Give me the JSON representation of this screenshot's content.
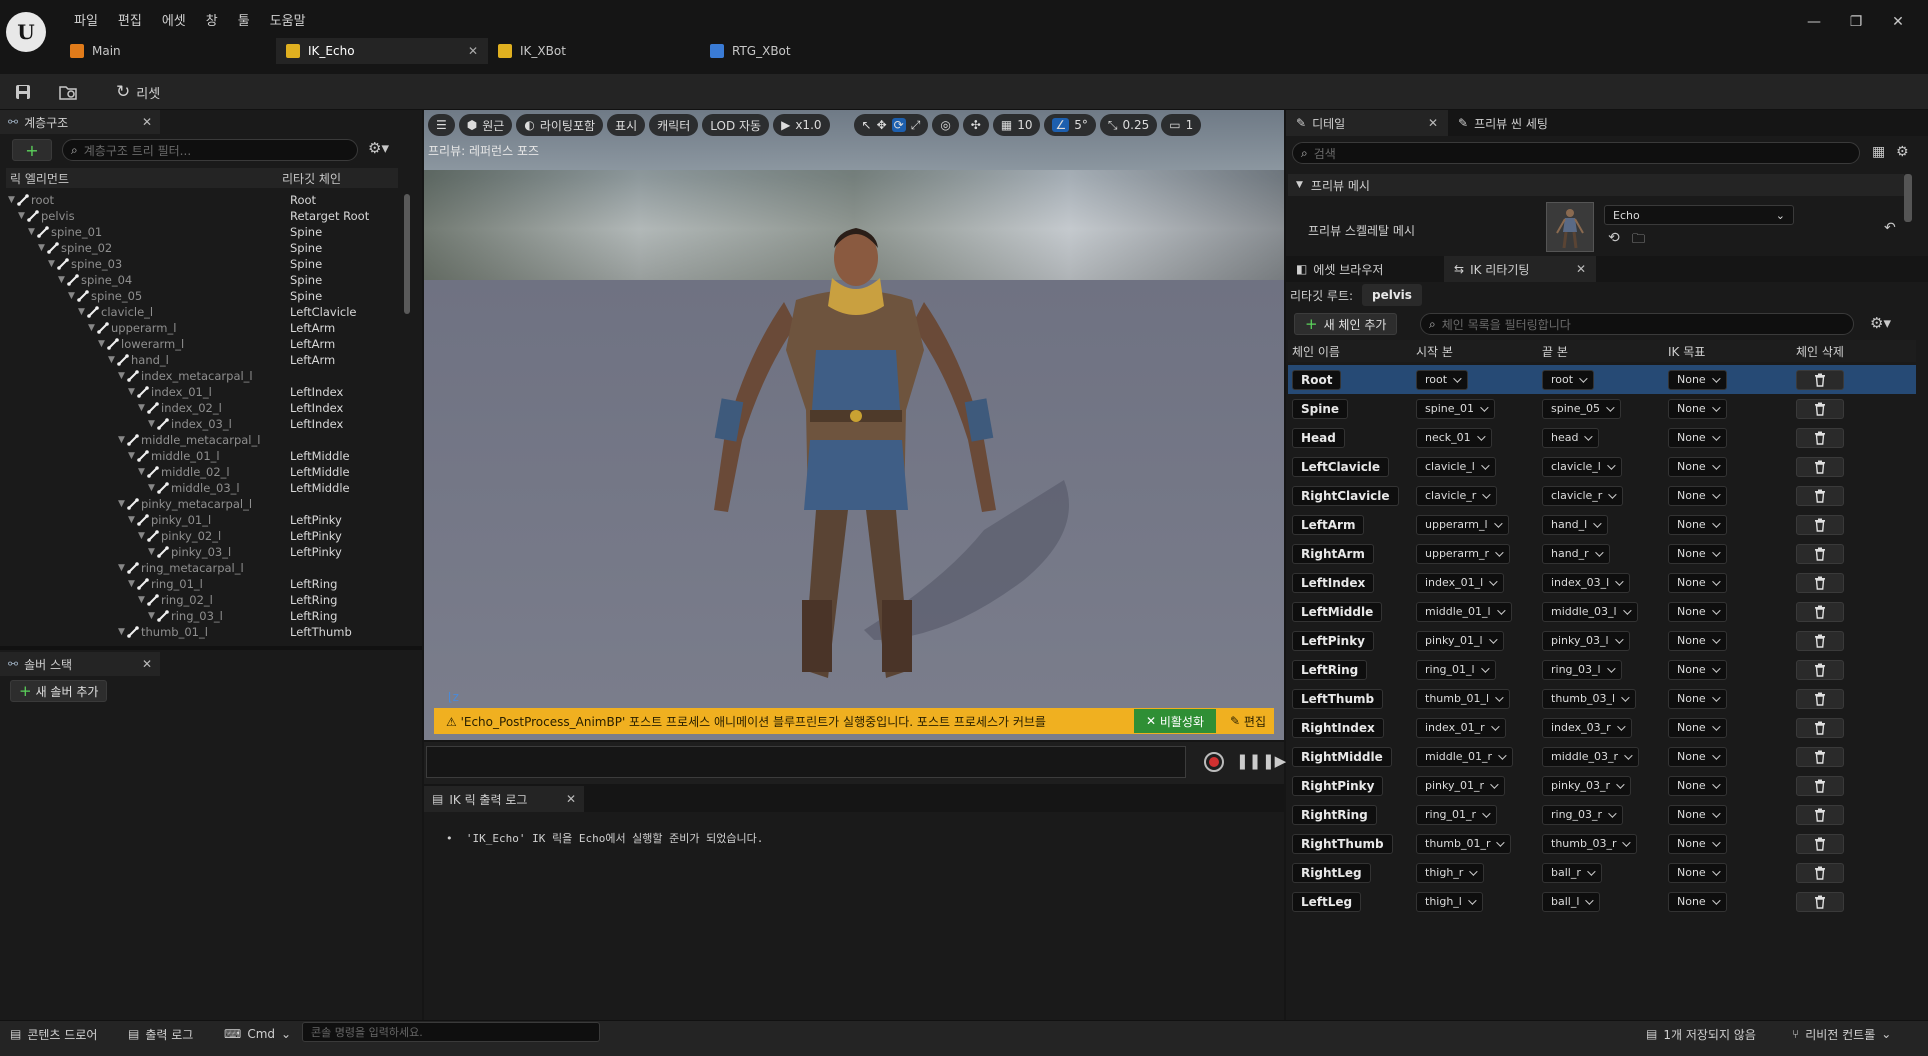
{
  "menu": {
    "file": "파일",
    "edit": "편집",
    "asset": "에셋",
    "window": "창",
    "tools": "툴",
    "help": "도움말"
  },
  "doc_tabs": [
    {
      "label": "Main",
      "color": "#e07b1a"
    },
    {
      "label": "IK_Echo",
      "color": "#e0b020"
    },
    {
      "label": "IK_XBot",
      "color": "#e0b020"
    },
    {
      "label": "RTG_XBot",
      "color": "#3a7bd5"
    }
  ],
  "toolbar": {
    "reset_label": "리셋"
  },
  "hierarchy": {
    "tab_label": "계층구조",
    "search_placeholder": "계층구조 트리 필터...",
    "col_element": "릭 엘리먼트",
    "col_chain": "리타깃 체인",
    "rows": [
      {
        "name": "root",
        "chain": "Root",
        "depth": 0
      },
      {
        "name": "pelvis",
        "chain": "Retarget Root",
        "depth": 1
      },
      {
        "name": "spine_01",
        "chain": "Spine",
        "depth": 2
      },
      {
        "name": "spine_02",
        "chain": "Spine",
        "depth": 3
      },
      {
        "name": "spine_03",
        "chain": "Spine",
        "depth": 4
      },
      {
        "name": "spine_04",
        "chain": "Spine",
        "depth": 5
      },
      {
        "name": "spine_05",
        "chain": "Spine",
        "depth": 6
      },
      {
        "name": "clavicle_l",
        "chain": "LeftClavicle",
        "depth": 7
      },
      {
        "name": "upperarm_l",
        "chain": "LeftArm",
        "depth": 8
      },
      {
        "name": "lowerarm_l",
        "chain": "LeftArm",
        "depth": 9
      },
      {
        "name": "hand_l",
        "chain": "LeftArm",
        "depth": 10
      },
      {
        "name": "index_metacarpal_l",
        "chain": "",
        "depth": 11
      },
      {
        "name": "index_01_l",
        "chain": "LeftIndex",
        "depth": 12
      },
      {
        "name": "index_02_l",
        "chain": "LeftIndex",
        "depth": 13
      },
      {
        "name": "index_03_l",
        "chain": "LeftIndex",
        "depth": 14
      },
      {
        "name": "middle_metacarpal_l",
        "chain": "",
        "depth": 11
      },
      {
        "name": "middle_01_l",
        "chain": "LeftMiddle",
        "depth": 12
      },
      {
        "name": "middle_02_l",
        "chain": "LeftMiddle",
        "depth": 13
      },
      {
        "name": "middle_03_l",
        "chain": "LeftMiddle",
        "depth": 14
      },
      {
        "name": "pinky_metacarpal_l",
        "chain": "",
        "depth": 11
      },
      {
        "name": "pinky_01_l",
        "chain": "LeftPinky",
        "depth": 12
      },
      {
        "name": "pinky_02_l",
        "chain": "LeftPinky",
        "depth": 13
      },
      {
        "name": "pinky_03_l",
        "chain": "LeftPinky",
        "depth": 14
      },
      {
        "name": "ring_metacarpal_l",
        "chain": "",
        "depth": 11
      },
      {
        "name": "ring_01_l",
        "chain": "LeftRing",
        "depth": 12
      },
      {
        "name": "ring_02_l",
        "chain": "LeftRing",
        "depth": 13
      },
      {
        "name": "ring_03_l",
        "chain": "LeftRing",
        "depth": 14
      },
      {
        "name": "thumb_01_l",
        "chain": "LeftThumb",
        "depth": 11
      }
    ]
  },
  "solver": {
    "tab_label": "솔버 스택",
    "add_label": "새 솔버 추가"
  },
  "viewport": {
    "buttons": {
      "perspective": "원근",
      "lighting": "라이팅포함",
      "show": "표시",
      "character": "캐릭터",
      "lod": "LOD 자동",
      "speed": "x1.0",
      "grid": "10",
      "angle": "5°",
      "scale": "0.25",
      "camera": "1"
    },
    "preview_label": "프리뷰: 레퍼런스 포즈",
    "warning": "'Echo_PostProcess_AnimBP' 포스트 프로세스 애니메이션 블루프린트가 실행중입니다. 포스트 프로세스가 커브를",
    "disable_label": "비활성화",
    "edit_label": "편집"
  },
  "log": {
    "tab_label": "IK 릭 출력 로그",
    "message": "'IK_Echo' IK 릭을 Echo에서 실행할 준비가 되었습니다."
  },
  "details": {
    "tab_label": "디테일",
    "preview_settings_label": "프리뷰 씬 세팅",
    "search_placeholder": "검색",
    "category": "프리뷰 메시",
    "mesh_label": "프리뷰 스켈레탈 메시",
    "mesh_value": "Echo"
  },
  "retarget": {
    "asset_browser_label": "에셋 브라우저",
    "tab_label": "IK 리타기팅",
    "root_label": "리타깃 루트:",
    "root_value": "pelvis",
    "add_chain_label": "새 체인 추가",
    "filter_placeholder": "체인 목록을 필터링합니다",
    "headers": {
      "name": "체인 이름",
      "start": "시작 본",
      "end": "끝 본",
      "goal": "IK 목표",
      "delete": "체인 삭제"
    },
    "chains": [
      {
        "name": "Root",
        "start": "root",
        "end": "root",
        "goal": "None"
      },
      {
        "name": "Spine",
        "start": "spine_01",
        "end": "spine_05",
        "goal": "None"
      },
      {
        "name": "Head",
        "start": "neck_01",
        "end": "head",
        "goal": "None"
      },
      {
        "name": "LeftClavicle",
        "start": "clavicle_l",
        "end": "clavicle_l",
        "goal": "None"
      },
      {
        "name": "RightClavicle",
        "start": "clavicle_r",
        "end": "clavicle_r",
        "goal": "None"
      },
      {
        "name": "LeftArm",
        "start": "upperarm_l",
        "end": "hand_l",
        "goal": "None"
      },
      {
        "name": "RightArm",
        "start": "upperarm_r",
        "end": "hand_r",
        "goal": "None"
      },
      {
        "name": "LeftIndex",
        "start": "index_01_l",
        "end": "index_03_l",
        "goal": "None"
      },
      {
        "name": "LeftMiddle",
        "start": "middle_01_l",
        "end": "middle_03_l",
        "goal": "None"
      },
      {
        "name": "LeftPinky",
        "start": "pinky_01_l",
        "end": "pinky_03_l",
        "goal": "None"
      },
      {
        "name": "LeftRing",
        "start": "ring_01_l",
        "end": "ring_03_l",
        "goal": "None"
      },
      {
        "name": "LeftThumb",
        "start": "thumb_01_l",
        "end": "thumb_03_l",
        "goal": "None"
      },
      {
        "name": "RightIndex",
        "start": "index_01_r",
        "end": "index_03_r",
        "goal": "None"
      },
      {
        "name": "RightMiddle",
        "start": "middle_01_r",
        "end": "middle_03_r",
        "goal": "None"
      },
      {
        "name": "RightPinky",
        "start": "pinky_01_r",
        "end": "pinky_03_r",
        "goal": "None"
      },
      {
        "name": "RightRing",
        "start": "ring_01_r",
        "end": "ring_03_r",
        "goal": "None"
      },
      {
        "name": "RightThumb",
        "start": "thumb_01_r",
        "end": "thumb_03_r",
        "goal": "None"
      },
      {
        "name": "RightLeg",
        "start": "thigh_r",
        "end": "ball_r",
        "goal": "None"
      },
      {
        "name": "LeftLeg",
        "start": "thigh_l",
        "end": "ball_l",
        "goal": "None"
      }
    ]
  },
  "statusbar": {
    "content_drawer": "콘텐츠 드로어",
    "output_log": "출력 로그",
    "cmd": "Cmd",
    "console_placeholder": "콘솔 명령을 입력하세요.",
    "unsaved": "1개 저장되지 않음",
    "revision": "리비전 컨트롤"
  }
}
